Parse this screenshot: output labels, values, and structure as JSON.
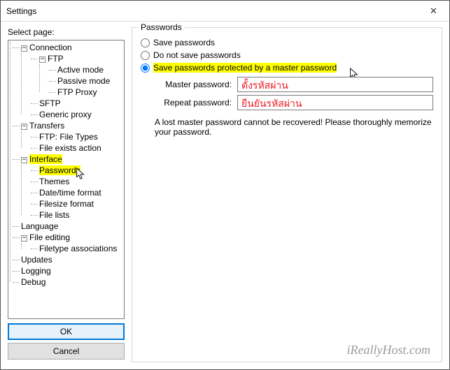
{
  "window": {
    "title": "Settings"
  },
  "left": {
    "label": "Select page:",
    "ok": "OK",
    "cancel": "Cancel"
  },
  "tree": {
    "connection": "Connection",
    "ftp": "FTP",
    "active": "Active mode",
    "passive": "Passive mode",
    "proxy": "FTP Proxy",
    "sftp": "SFTP",
    "generic": "Generic proxy",
    "transfers": "Transfers",
    "filetypes": "FTP: File Types",
    "fileexists": "File exists action",
    "interface": "Interface",
    "passwords": "Passwords",
    "themes": "Themes",
    "datetime": "Date/time format",
    "filesize": "Filesize format",
    "filelists": "File lists",
    "language": "Language",
    "fileedit": "File editing",
    "filetypeassoc": "Filetype associations",
    "updates": "Updates",
    "logging": "Logging",
    "debug": "Debug",
    "minus": "−",
    "plus": "+"
  },
  "panel": {
    "group": "Passwords",
    "opt1": "Save passwords",
    "opt2": "Do not save passwords",
    "opt3": "Save passwords protected by a master password",
    "masterLabel": "Master password:",
    "repeatLabel": "Repeat password:",
    "hint1": "ตั้งรหัสผ่าน",
    "hint2": "ยืนยันรหัสผ่าน",
    "warn": "A lost master password cannot be recovered! Please thoroughly memorize your password."
  },
  "watermark": "iReallyHost.com"
}
